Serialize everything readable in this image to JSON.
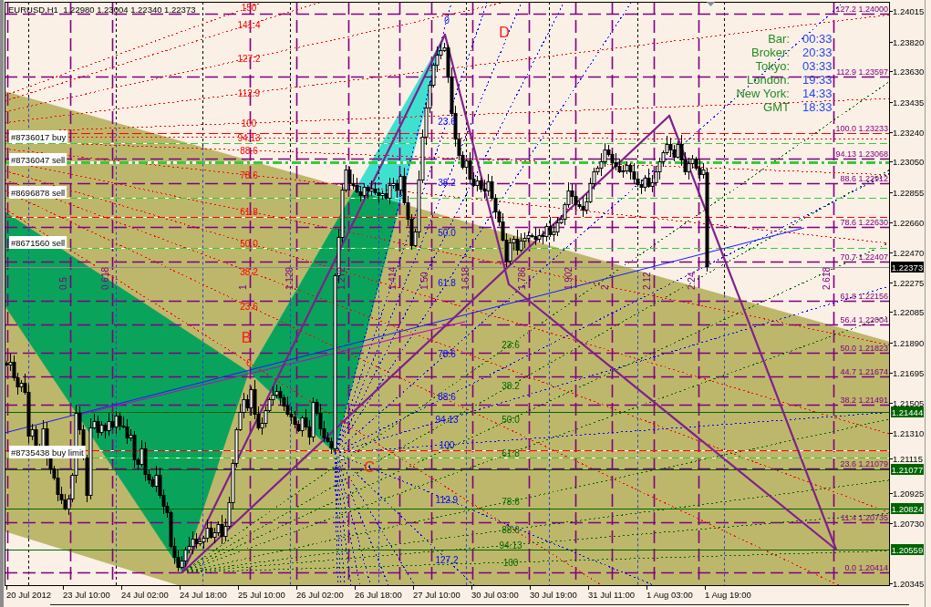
{
  "chart_title": "EURUSD,H1  1.22980 1.23004 1.22340 1.22373",
  "clock_panel": [
    {
      "label": "Bar:",
      "value": "00:33"
    },
    {
      "label": "Broker:",
      "value": "20:33"
    },
    {
      "label": "Tokyo:",
      "value": "03:33"
    },
    {
      "label": "London:",
      "value": "19:33"
    },
    {
      "label": "New York:",
      "value": "14:33"
    },
    {
      "label": "GMT",
      "value": "18:33"
    }
  ],
  "pattern_points": [
    "B",
    "C",
    "D"
  ],
  "order_tags": [
    "#8736017 buy",
    "#8736047 sell",
    "#8696878 sell",
    "#8671560 sell",
    "#8735438 buy limit"
  ],
  "fib_fans": [
    {
      "color": "#ff0000",
      "labels": [
        "150",
        "141.4",
        "127.2",
        "112.9",
        "100",
        "94.13",
        "88.6",
        "78.6",
        "61.8",
        "50.0",
        "38.2",
        "23.6",
        "0"
      ]
    },
    {
      "color": "#0000ff",
      "labels": [
        "0",
        "23.6",
        "38.2",
        "50.0",
        "61.8",
        "78.6",
        "88.6",
        "94.13",
        "100",
        "112.9",
        "127.2"
      ]
    },
    {
      "color": "#006400",
      "labels": [
        "23.6",
        "38.2",
        "50.0",
        "61.8",
        "78.6",
        "88.6",
        "94.13",
        "100"
      ]
    }
  ],
  "fib_time_labels": [
    "0.5",
    "0.618",
    "1",
    "1.129",
    "1.272",
    "1.414",
    "1.50",
    "1.618",
    "1.786",
    "1.902",
    "2",
    "2.12",
    "2.24",
    "2.618"
  ],
  "fib_levels": [
    {
      "ratio": "127.2",
      "price": "1.24000"
    },
    {
      "ratio": "112.9",
      "price": "1.23597"
    },
    {
      "ratio": "100.0",
      "price": "1.23233"
    },
    {
      "ratio": "94.13",
      "price": "1.23068"
    },
    {
      "ratio": "88.6",
      "price": "1.22912"
    },
    {
      "ratio": "78.6",
      "price": "1.22630"
    },
    {
      "ratio": "70.7",
      "price": "1.22407"
    },
    {
      "ratio": "61.8",
      "price": "1.22156"
    },
    {
      "ratio": "56.4",
      "price": "1.22004"
    },
    {
      "ratio": "50.0",
      "price": "1.21823"
    },
    {
      "ratio": "44.7",
      "price": "1.21674"
    },
    {
      "ratio": "38.2",
      "price": "1.21491"
    },
    {
      "ratio": "23.6",
      "price": "1.21079"
    },
    {
      "ratio": "11.4",
      "price": "1.20735"
    },
    {
      "ratio": "0.0",
      "price": "1.20414"
    }
  ],
  "price_axis": [
    "1.24015",
    "1.23820",
    "1.23630",
    "1.23435",
    "1.23240",
    "1.23050",
    "1.22855",
    "1.22660",
    "1.22470",
    "1.22275",
    "1.22085",
    "1.21890",
    "1.21695",
    "1.21505",
    "1.21310",
    "1.21115",
    "1.20925",
    "1.20730",
    "1.20345"
  ],
  "price_tags": [
    {
      "kind": "bid",
      "text": "1.22373"
    },
    {
      "kind": "alert",
      "text": "1.21444"
    },
    {
      "kind": "alert",
      "text": "1.21077"
    },
    {
      "kind": "alert",
      "text": "1.20824"
    },
    {
      "kind": "alert",
      "text": "1.20559"
    }
  ],
  "time_axis": [
    "20 Jul 2012",
    "23 Jul 10:00",
    "24 Jul 02:00",
    "24 Jul 18:00",
    "25 Jul 10:00",
    "26 Jul 02:00",
    "26 Jul 18:00",
    "27 Jul 10:00",
    "30 Jul 03:00",
    "30 Jul 19:00",
    "31 Jul 11:00",
    "1 Aug 03:00",
    "1 Aug 19:00"
  ]
}
